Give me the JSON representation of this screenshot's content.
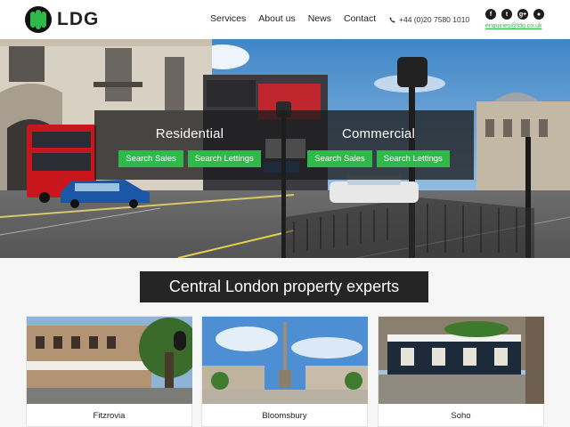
{
  "brand": {
    "name": "LDG",
    "accent": "#2fb94a"
  },
  "nav": {
    "items": [
      "Services",
      "About us",
      "News",
      "Contact"
    ]
  },
  "contact": {
    "phone": "+44 (0)20 7580 1010",
    "email": "enquiries@ldg.co.uk"
  },
  "social": {
    "icons": [
      "facebook-icon",
      "twitter-icon",
      "google-plus-icon",
      "rss-icon"
    ],
    "glyphs": [
      "f",
      "t",
      "g+",
      "●"
    ]
  },
  "hero": {
    "residential": {
      "title": "Residential",
      "sales": "Search Sales",
      "lettings": "Search Lettings"
    },
    "commercial": {
      "title": "Commercial",
      "sales": "Search Sales",
      "lettings": "Search Lettings"
    }
  },
  "tagline": "Central London property experts",
  "areas": [
    {
      "name": "Fitzrovia"
    },
    {
      "name": "Bloomsbury"
    },
    {
      "name": "Soho"
    }
  ]
}
